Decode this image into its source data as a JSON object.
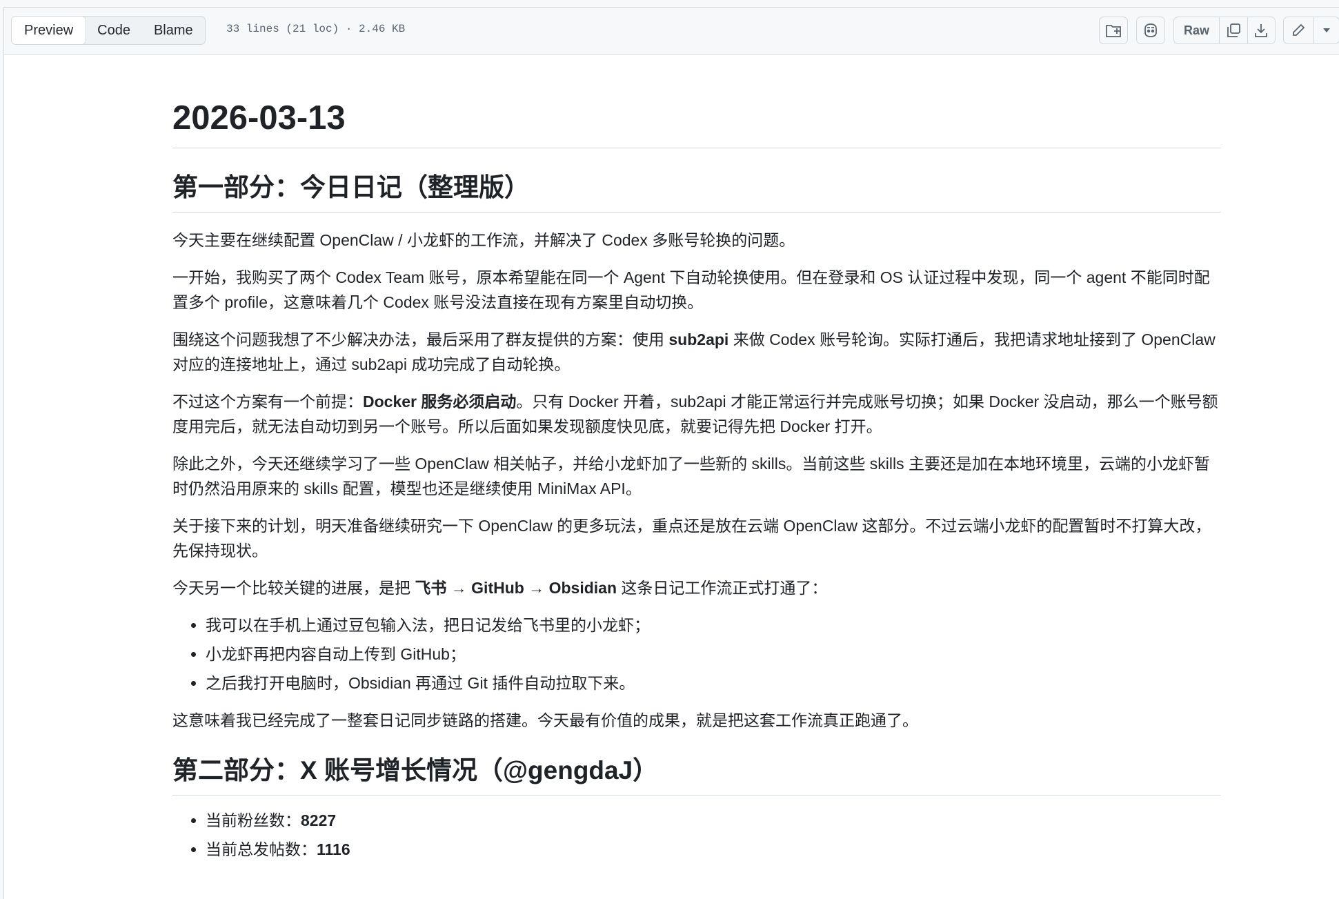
{
  "toolbar": {
    "tabs": [
      "Preview",
      "Code",
      "Blame"
    ],
    "active_tab": "Preview",
    "file_info": "33 lines (21 loc) · 2.46 KB",
    "raw_label": "Raw",
    "icons": [
      "file-move-icon",
      "copilot-icon",
      "copy-icon",
      "download-icon",
      "pencil-icon",
      "triangle-down-icon"
    ]
  },
  "doc": {
    "title": "2026-03-13",
    "section1": {
      "heading": "第一部分：今日日记（整理版）",
      "p1": "今天主要在继续配置 OpenClaw / 小龙虾的工作流，并解决了 Codex 多账号轮换的问题。",
      "p2": "一开始，我购买了两个 Codex Team 账号，原本希望能在同一个 Agent 下自动轮换使用。但在登录和 OS 认证过程中发现，同一个 agent 不能同时配置多个 profile，这意味着几个 Codex 账号没法直接在现有方案里自动切换。",
      "p3_a": "围绕这个问题我想了不少解决办法，最后采用了群友提供的方案：使用 ",
      "p3_b": "sub2api",
      "p3_c": " 来做 Codex 账号轮询。实际打通后，我把请求地址接到了 OpenClaw 对应的连接地址上，通过 sub2api 成功完成了自动轮换。",
      "p4_a": "不过这个方案有一个前提：",
      "p4_b": "Docker 服务必须启动",
      "p4_c": "。只有 Docker 开着，sub2api 才能正常运行并完成账号切换；如果 Docker 没启动，那么一个账号额度用完后，就无法自动切到另一个账号。所以后面如果发现额度快见底，就要记得先把 Docker 打开。",
      "p5": "除此之外，今天还继续学习了一些 OpenClaw 相关帖子，并给小龙虾加了一些新的 skills。当前这些 skills 主要还是加在本地环境里，云端的小龙虾暂时仍然沿用原来的 skills 配置，模型也还是继续使用 MiniMax API。",
      "p6": "关于接下来的计划，明天准备继续研究一下 OpenClaw 的更多玩法，重点还是放在云端 OpenClaw 这部分。不过云端小龙虾的配置暂时不打算大改，先保持现状。",
      "p7_a": "今天另一个比较关键的进展，是把 ",
      "p7_b": "飞书 → GitHub → Obsidian",
      "p7_c": " 这条日记工作流正式打通了：",
      "list": [
        "我可以在手机上通过豆包输入法，把日记发给飞书里的小龙虾；",
        "小龙虾再把内容自动上传到 GitHub；",
        "之后我打开电脑时，Obsidian 再通过 Git 插件自动拉取下来。"
      ],
      "p8": "这意味着我已经完成了一整套日记同步链路的搭建。今天最有价值的成果，就是把这套工作流真正跑通了。"
    },
    "section2": {
      "heading": "第二部分：X 账号增长情况（@gengdaJ）",
      "followers_label": "当前粉丝数：",
      "followers_value": "8227",
      "posts_label": "当前总发帖数：",
      "posts_value": "1116"
    }
  }
}
